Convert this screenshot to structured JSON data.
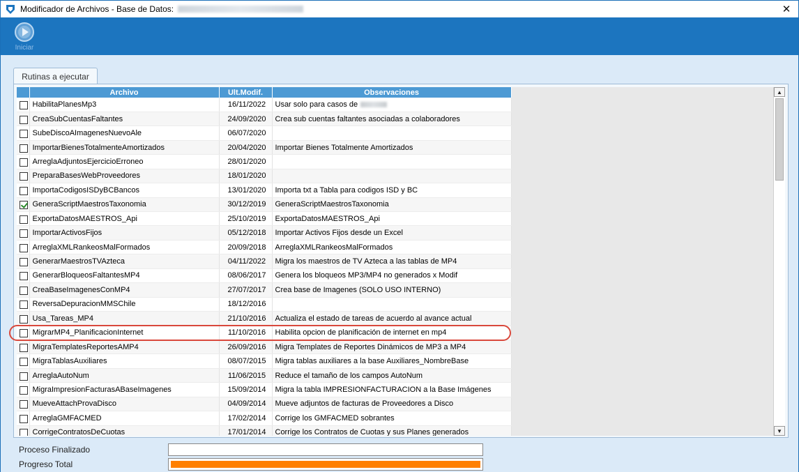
{
  "window": {
    "title": "Modificador de Archivos - Base de Datos:",
    "close_label": "✕"
  },
  "toolbar": {
    "start_label": "Iniciar"
  },
  "tab": {
    "label": "Rutinas a ejecutar"
  },
  "grid": {
    "columns": [
      "Archivo",
      "Ult.Modif.",
      "Observaciones"
    ],
    "rows": [
      {
        "checked": false,
        "archivo": "HabilitaPlanesMp3",
        "fecha": "16/11/2022",
        "obs": "Usar solo para casos de",
        "obs_redacted": true
      },
      {
        "checked": false,
        "archivo": "CreaSubCuentasFaltantes",
        "fecha": "24/09/2020",
        "obs": "Crea sub cuentas faltantes asociadas a colaboradores"
      },
      {
        "checked": false,
        "archivo": "SubeDiscoAImagenesNuevoAle",
        "fecha": "06/07/2020",
        "obs": ""
      },
      {
        "checked": false,
        "archivo": "ImportarBienesTotalmenteAmortizados",
        "fecha": "20/04/2020",
        "obs": "Importar Bienes Totalmente Amortizados"
      },
      {
        "checked": false,
        "archivo": "ArreglaAdjuntosEjercicioErroneo",
        "fecha": "28/01/2020",
        "obs": ""
      },
      {
        "checked": false,
        "archivo": "PreparaBasesWebProveedores",
        "fecha": "18/01/2020",
        "obs": ""
      },
      {
        "checked": false,
        "archivo": "ImportaCodigosISDyBCBancos",
        "fecha": "13/01/2020",
        "obs": "Importa txt a Tabla para codigos ISD y BC"
      },
      {
        "checked": true,
        "archivo": "GeneraScriptMaestrosTaxonomia",
        "fecha": "30/12/2019",
        "obs": "GeneraScriptMaestrosTaxonomia"
      },
      {
        "checked": false,
        "archivo": "ExportaDatosMAESTROS_Api",
        "fecha": "25/10/2019",
        "obs": "ExportaDatosMAESTROS_Api"
      },
      {
        "checked": false,
        "archivo": "ImportarActivosFijos",
        "fecha": "05/12/2018",
        "obs": "Importar Activos Fijos desde un Excel"
      },
      {
        "checked": false,
        "archivo": "ArreglaXMLRankeosMalFormados",
        "fecha": "20/09/2018",
        "obs": "ArreglaXMLRankeosMalFormados"
      },
      {
        "checked": false,
        "archivo": "GenerarMaestrosTVAzteca",
        "fecha": "04/11/2022",
        "obs": "Migra los maestros de TV Azteca a las tablas de MP4"
      },
      {
        "checked": false,
        "archivo": "GenerarBloqueosFaltantesMP4",
        "fecha": "08/06/2017",
        "obs": "Genera los bloqueos MP3/MP4 no generados x Modif"
      },
      {
        "checked": false,
        "archivo": "CreaBaseImagenesConMP4",
        "fecha": "27/07/2017",
        "obs": "Crea base de Imagenes (SOLO USO INTERNO)"
      },
      {
        "checked": false,
        "archivo": "ReversaDepuracionMMSChile",
        "fecha": "18/12/2016",
        "obs": ""
      },
      {
        "checked": false,
        "archivo": "Usa_Tareas_MP4",
        "fecha": "21/10/2016",
        "obs": "Actualiza el estado de tareas de acuerdo al avance actual"
      },
      {
        "checked": false,
        "archivo": "MigrarMP4_PlanificacionInternet",
        "fecha": "11/10/2016",
        "obs": "Habilita opcion de planificación de internet en mp4"
      },
      {
        "checked": false,
        "archivo": "MigraTemplatesReportesAMP4",
        "fecha": "26/09/2016",
        "obs": "Migra Templates de Reportes Dinámicos de MP3 a MP4"
      },
      {
        "checked": false,
        "archivo": "MigraTablasAuxiliares",
        "fecha": "08/07/2015",
        "obs": "Migra tablas auxiliares a la base Auxiliares_NombreBase"
      },
      {
        "checked": false,
        "archivo": "ArreglaAutoNum",
        "fecha": "11/06/2015",
        "obs": "Reduce el tamaño de los campos AutoNum"
      },
      {
        "checked": false,
        "archivo": "MigraImpresionFacturasABaseImagenes",
        "fecha": "15/09/2014",
        "obs": "Migra la tabla IMPRESIONFACTURACION a la Base Imágenes"
      },
      {
        "checked": false,
        "archivo": "MueveAttachProvaDisco",
        "fecha": "04/09/2014",
        "obs": "Mueve adjuntos de facturas de Proveedores a Disco"
      },
      {
        "checked": false,
        "archivo": "ArreglaGMFACMED",
        "fecha": "17/02/2014",
        "obs": "Corrige los GMFACMED sobrantes"
      },
      {
        "checked": false,
        "archivo": "CorrigeContratosDeCuotas",
        "fecha": "17/01/2014",
        "obs": "Corrige los Contratos de Cuotas y sus Planes generados"
      }
    ]
  },
  "status": {
    "proceso_label": "Proceso Finalizado",
    "progreso_label": "Progreso Total",
    "proceso_fraction": 0.0,
    "progreso_fraction": 1.0
  },
  "colors": {
    "toolbar": "#1c75bf",
    "header": "#4d9ad4",
    "highlight": "#d9483b",
    "progress": "#ff7f00"
  }
}
